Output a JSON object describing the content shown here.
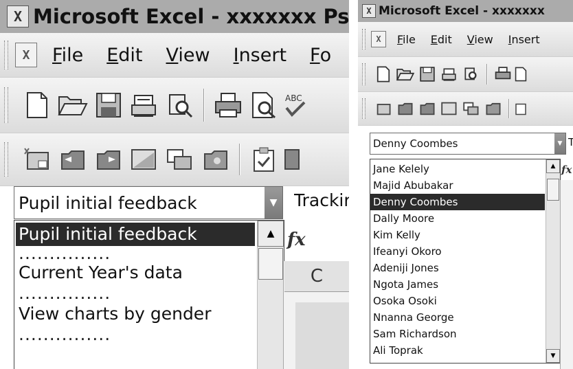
{
  "left": {
    "title": "Microsoft Excel - xxxxxxx Psca",
    "menu": [
      {
        "label": "File",
        "key": "F",
        "rest": "ile"
      },
      {
        "label": "Edit",
        "key": "E",
        "rest": "dit"
      },
      {
        "label": "View",
        "key": "V",
        "rest": "iew"
      },
      {
        "label": "Insert",
        "key": "I",
        "rest": "nsert"
      },
      {
        "label": "Fo",
        "key": "F",
        "rest": "o"
      }
    ],
    "combo_value": "Pupil initial feedback",
    "combo_next_label": "Trackir",
    "dropdown_items": [
      {
        "text": "Pupil initial feedback",
        "selected": true
      },
      {
        "text": "...............",
        "separator": true
      },
      {
        "text": "Current Year's data"
      },
      {
        "text": "...............",
        "separator": true
      },
      {
        "text": "View charts by gender"
      },
      {
        "text": "...............",
        "separator": true
      }
    ],
    "fx_label": "fx",
    "column_header": "C"
  },
  "right": {
    "title": "Microsoft Excel - xxxxxxx",
    "menu": [
      {
        "label": "File",
        "key": "F",
        "rest": "ile"
      },
      {
        "label": "Edit",
        "key": "E",
        "rest": "dit"
      },
      {
        "label": "View",
        "key": "V",
        "rest": "iew"
      },
      {
        "label": "Insert",
        "key": "I",
        "rest": "nsert"
      }
    ],
    "combo_value": "Denny Coombes",
    "combo_next_label": "T",
    "dropdown_items": [
      {
        "text": "Jane Kelely"
      },
      {
        "text": "Majid Abubakar"
      },
      {
        "text": "Denny Coombes",
        "selected": true
      },
      {
        "text": "Dally Moore"
      },
      {
        "text": "Kim Kelly"
      },
      {
        "text": "Ifeanyi Okoro"
      },
      {
        "text": "Adeniji Jones"
      },
      {
        "text": "Ngota James"
      },
      {
        "text": "Osoka Osoki"
      },
      {
        "text": "Nnanna George"
      },
      {
        "text": "Sam Richardson"
      },
      {
        "text": "Ali Toprak"
      }
    ],
    "fx_label": "fx"
  },
  "icons": {
    "standard_toolbar": [
      "new-icon",
      "open-icon",
      "save-icon",
      "permission-icon",
      "research-icon",
      "print-icon",
      "print-preview-icon",
      "spelling-icon"
    ],
    "forms_toolbar": [
      "label-icon",
      "group-box-icon",
      "button-icon",
      "checkbox-icon",
      "option-icon",
      "list-box-icon",
      "form-checkbox-icon",
      "properties-icon"
    ]
  },
  "colors": {
    "title_bar": "#ababab",
    "selection": "#2b2b2b",
    "dropdown_arrow": "#888888"
  }
}
